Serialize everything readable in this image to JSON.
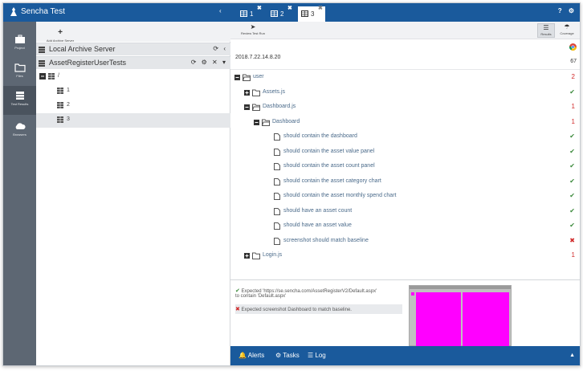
{
  "app": {
    "title": "Sencha Test",
    "collapse_glyph": "‹"
  },
  "nav": [
    {
      "label": "Project",
      "icon": "briefcase-icon"
    },
    {
      "label": "Files",
      "icon": "folder-icon"
    },
    {
      "label": "Test Results",
      "icon": "results-icon"
    },
    {
      "label": "Browsers",
      "icon": "cloud-icon"
    }
  ],
  "left": {
    "add_archive_label": "Add Archive Server",
    "server": {
      "label": "Local Archive Server",
      "actions": "⟳ ‹"
    },
    "archive": {
      "label": "AssetRegisterUserTests",
      "actions": "⟳ ⚙ ✕ ▾"
    },
    "tree": [
      {
        "label": "/",
        "level": 0,
        "toggle": "minus"
      },
      {
        "label": "1",
        "level": 1
      },
      {
        "label": "2",
        "level": 1
      },
      {
        "label": "3",
        "level": 1,
        "selected": true
      }
    ]
  },
  "tabs": [
    {
      "num": "1",
      "close": "✖",
      "active": false
    },
    {
      "num": "2",
      "close": "✖",
      "active": false
    },
    {
      "num": "3",
      "close": "✖",
      "active": true
    }
  ],
  "header_icons": "? ⚙",
  "toolbar": {
    "review_label": "Review Test Run",
    "results_label": "Results",
    "coverage_label": "Coverage"
  },
  "run": {
    "date": "2018.7.22.14.8.20",
    "count": "67"
  },
  "tree_rows": [
    {
      "label": "user",
      "level": 0,
      "toggle": "minus",
      "open": true,
      "status": "2",
      "status_class": "bad"
    },
    {
      "label": "Assets.js",
      "level": 1,
      "toggle": "plus",
      "status": "✔",
      "status_class": "ok"
    },
    {
      "label": "Dashboard.js",
      "level": 1,
      "toggle": "minus",
      "open": true,
      "status": "1",
      "status_class": "bad"
    },
    {
      "label": "Dashboard",
      "level": 2,
      "toggle": "minus",
      "open": true,
      "status": "1",
      "status_class": "bad"
    },
    {
      "label": "should contain the dashboard",
      "level": 3,
      "test": true,
      "status": "✔",
      "status_class": "ok"
    },
    {
      "label": "should contain the asset value panel",
      "level": 3,
      "test": true,
      "status": "✔",
      "status_class": "ok"
    },
    {
      "label": "should contain the asset count panel",
      "level": 3,
      "test": true,
      "status": "✔",
      "status_class": "ok"
    },
    {
      "label": "should contain the asset category chart",
      "level": 3,
      "test": true,
      "status": "✔",
      "status_class": "ok"
    },
    {
      "label": "should contain the asset monthly spend chart",
      "level": 3,
      "test": true,
      "status": "✔",
      "status_class": "ok"
    },
    {
      "label": "should have an asset count",
      "level": 3,
      "test": true,
      "status": "✔",
      "status_class": "ok"
    },
    {
      "label": "should have an asset value",
      "level": 3,
      "test": true,
      "status": "✔",
      "status_class": "ok"
    },
    {
      "label": "screenshot should match baseline",
      "level": 3,
      "test": true,
      "status": "✖",
      "status_class": "bad"
    },
    {
      "label": "Login.js",
      "level": 1,
      "toggle": "plus",
      "status": "1",
      "status_class": "bad"
    }
  ],
  "messages": [
    {
      "line1": "Expected 'https://se.sencha.com/AssetRegisterV2/Default.aspx'",
      "line2": "to contain 'Default.aspx'",
      "mark": "✔",
      "mark_class": "ok"
    },
    {
      "line1": "Expected screenshot Dashboard to match baseline.",
      "mark": "✖",
      "mark_class": "bad"
    }
  ],
  "footer": {
    "alerts": "Alerts",
    "tasks": "Tasks",
    "log": "Log",
    "caret": "▲"
  },
  "colors": {
    "brand": "#1a5a9c",
    "nav": "#5d6773",
    "pass": "#3c8a3c",
    "fail": "#d12a2a",
    "diff": "#ff00ff"
  }
}
